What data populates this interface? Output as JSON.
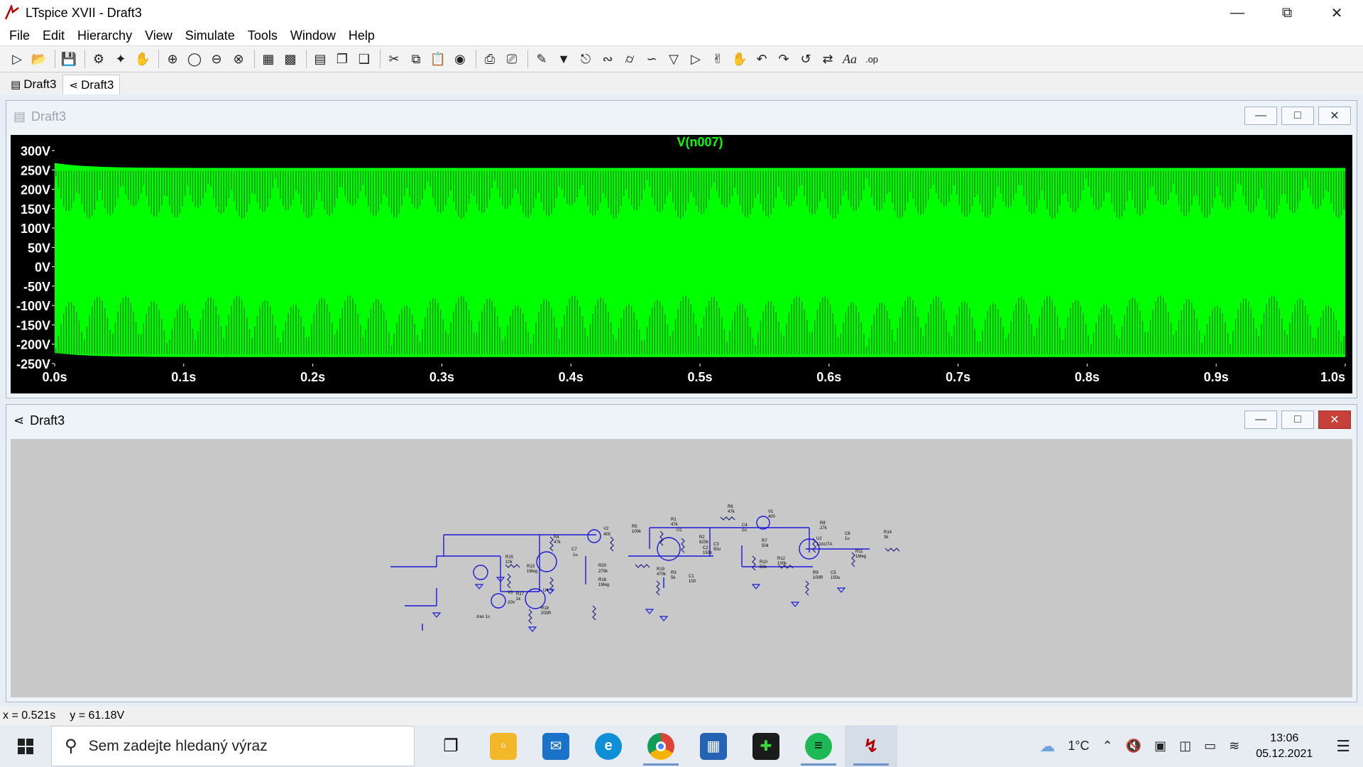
{
  "window": {
    "title": "LTspice XVII - Draft3"
  },
  "menu": [
    "File",
    "Edit",
    "Hierarchy",
    "View",
    "Simulate",
    "Tools",
    "Window",
    "Help"
  ],
  "tabs": [
    {
      "label": "Draft3",
      "icon": "waveform-icon"
    },
    {
      "label": "Draft3",
      "icon": "schematic-icon"
    }
  ],
  "waveform_window": {
    "title": "Draft3"
  },
  "schematic_window": {
    "title": "Draft3"
  },
  "chart_data": {
    "type": "line",
    "title": "V(n007)",
    "xlabel": "",
    "ylabel": "",
    "xlim": [
      0,
      1.0
    ],
    "ylim": [
      -250,
      300
    ],
    "x_ticks": [
      "0.0s",
      "0.1s",
      "0.2s",
      "0.3s",
      "0.4s",
      "0.5s",
      "0.6s",
      "0.7s",
      "0.8s",
      "0.9s",
      "1.0s"
    ],
    "y_ticks": [
      "300V",
      "250V",
      "200V",
      "150V",
      "100V",
      "50V",
      "0V",
      "-50V",
      "-100V",
      "-150V",
      "-200V",
      "-250V"
    ],
    "series": [
      {
        "name": "V(n007)",
        "color": "#00ff00",
        "envelope_max": 255,
        "envelope_min": -233,
        "initial_peak": 268,
        "initial_trough": -222,
        "inner_max": 20,
        "inner_min": -55
      }
    ]
  },
  "schematic": {
    "labels": [
      "R15",
      "10k",
      "R13",
      "1Meg",
      "R4",
      "47k",
      "C7",
      "1u",
      "V2",
      "400",
      "R20",
      "270k",
      "R16",
      "1Meg",
      "R5",
      "100k",
      "R1",
      "47k",
      "U1",
      "R2",
      "820k",
      "C2",
      "150n",
      "C3",
      "50u",
      "R6",
      "47k",
      "V1",
      "400",
      "C4",
      "1u",
      "R7",
      "50k",
      "R10",
      "50k",
      "R12",
      "100k",
      "R8",
      "27k",
      "U2",
      "12AU7A",
      "C6",
      "1u",
      "R11",
      "1Meg",
      "R14",
      "3k",
      "R9",
      "100R",
      "C5",
      "150u",
      "R19",
      "470k",
      "R3",
      "5k",
      "C1",
      "100",
      "R17",
      "1k",
      "V3",
      "20V",
      "U4",
      "R18",
      "200R",
      ".tran 1s"
    ]
  },
  "status": {
    "x": "x = 0.521s",
    "y": "y = 61.18V"
  },
  "taskbar": {
    "search_placeholder": "Sem zadejte hledaný výraz",
    "weather": "1°C",
    "time": "13:06",
    "date": "05.12.2021"
  }
}
